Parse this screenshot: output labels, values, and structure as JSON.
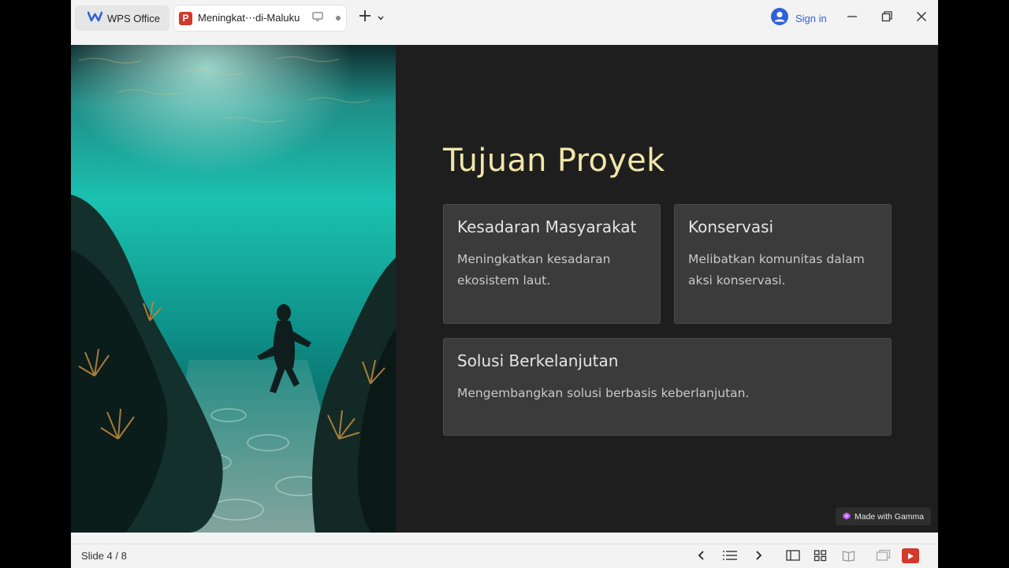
{
  "window": {
    "home_tab_label": "WPS Office",
    "doc_tab_label": "Meningkat⋯di-Maluku",
    "doc_tab_badge": "P",
    "sign_in_label": "Sign in"
  },
  "slide": {
    "title": "Tujuan Proyek",
    "cards": [
      {
        "title": "Kesadaran Masyarakat",
        "description": "Meningkatkan kesadaran ekosistem laut."
      },
      {
        "title": "Konservasi",
        "description": "Melibatkan komunitas  dalam aksi konservasi."
      },
      {
        "title": "Solusi Berkelanjutan",
        "description": "Mengembangkan solusi berbasis keberlanjutan."
      }
    ],
    "badge": "Made with Gamma"
  },
  "statusbar": {
    "slide_counter": "Slide 4 / 8"
  },
  "colors": {
    "slide_background": "#1e1e1e",
    "title": "#f1e6a7",
    "card": "#3b3b3c",
    "accent_blue": "#2f62d8",
    "ppt_red": "#d03a2f"
  },
  "icons": [
    "wps-logo-icon",
    "presentation-file-icon",
    "monitor-icon",
    "unsaved-dot-icon",
    "plus-icon",
    "chevron-down-icon",
    "account-icon",
    "minimize-icon",
    "restore-icon",
    "close-icon",
    "gamma-logo-icon",
    "previous-slide-icon",
    "slide-list-icon",
    "next-slide-icon",
    "normal-view-icon",
    "grid-view-icon",
    "reading-view-icon",
    "presenter-view-icon",
    "play-slideshow-icon"
  ]
}
